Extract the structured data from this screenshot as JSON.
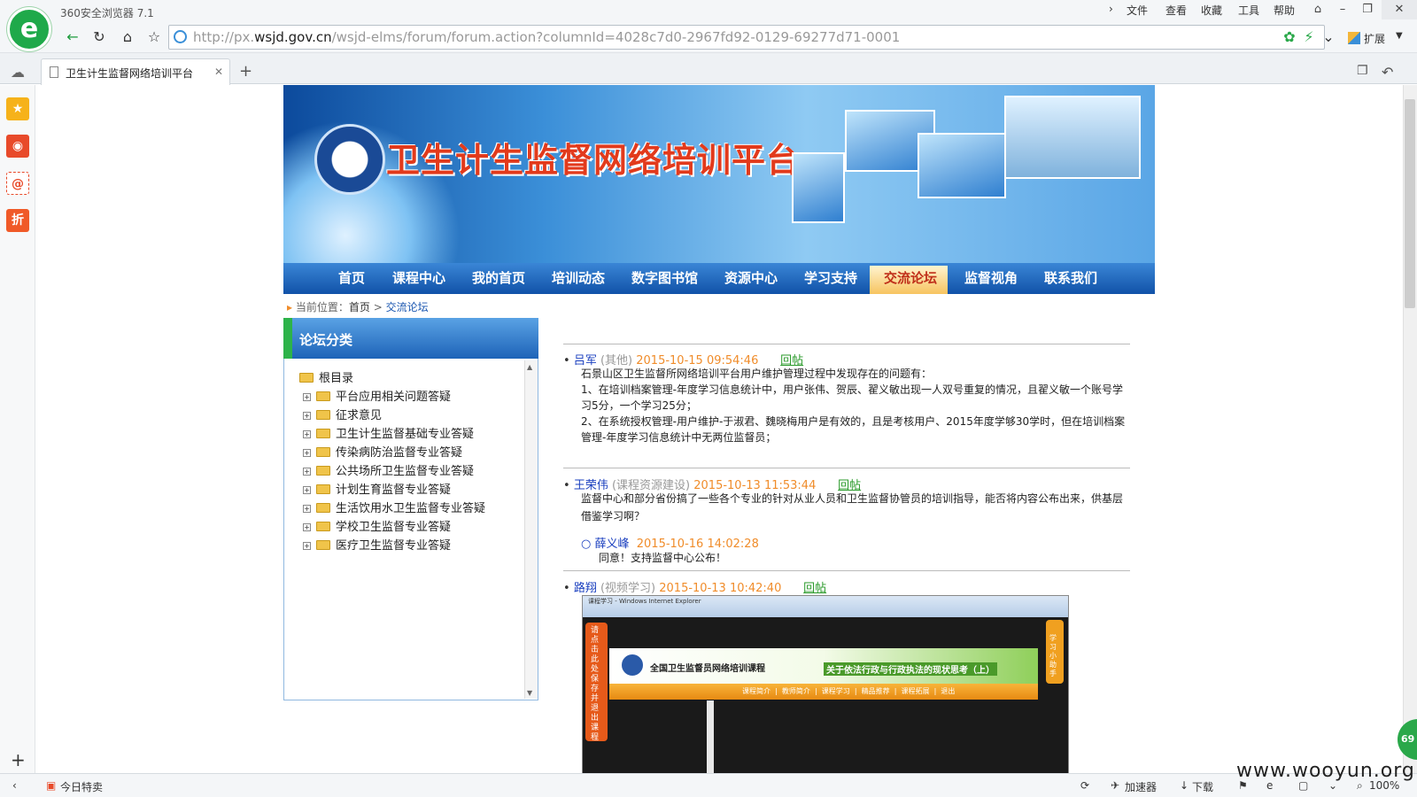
{
  "browser": {
    "app_name": "360安全浏览器 7.1",
    "menu": [
      "文件",
      "查看",
      "收藏",
      "工具",
      "帮助"
    ],
    "url_prefix": "http://px.",
    "url_domain": "wsjd.gov.cn",
    "url_path": "/wsjd-elms/forum/forum.action?columnId=4028c7d0-2967fd92-0129-69277d71-0001",
    "extend_label": "扩展",
    "tab_title": "卫生计生监督网络培训平台",
    "status": {
      "today_deal": "今日特卖",
      "accelerator": "加速器",
      "download": "下载",
      "zoom": "100%"
    }
  },
  "site": {
    "banner_title": "卫生计生监督网络培训平台",
    "nav": [
      "首页",
      "课程中心",
      "我的首页",
      "培训动态",
      "数字图书馆",
      "资源中心",
      "学习支持",
      "交流论坛",
      "监督视角",
      "联系我们"
    ],
    "active_nav": "交流论坛",
    "breadcrumb": {
      "label": "当前位置：",
      "home": "首页",
      "sep": ">",
      "current": "交流论坛"
    }
  },
  "categories": {
    "title": "论坛分类",
    "root": "根目录",
    "items": [
      "平台应用相关问题答疑",
      "征求意见",
      "卫生计生监督基础专业答疑",
      "传染病防治监督专业答疑",
      "公共场所卫生监督专业答疑",
      "计划生育监督专业答疑",
      "生活饮用水卫生监督专业答疑",
      "学校卫生监督专业答疑",
      "医疗卫生监督专业答疑"
    ]
  },
  "posts": [
    {
      "author": "吕军",
      "category": "(其他)",
      "time": "2015-10-15 09:54:46",
      "reply": "回帖",
      "lines": [
        "石景山区卫生监督所网络培训平台用户维护管理过程中发现存在的问题有：",
        "1、在培训档案管理-年度学习信息统计中，用户张伟、贺辰、翟义敏出现一人双号重复的情况，且翟义敏一个账号学",
        "习5分，一个学习25分；",
        "2、在系统授权管理-用户维护-于淑君、魏晓梅用户是有效的，且是考核用户、2015年度学够30学时，但在培训档案",
        "管理-年度学习信息统计中无两位监督员；"
      ]
    },
    {
      "author": "王荣伟",
      "category": "(课程资源建设)",
      "time": "2015-10-13 11:53:44",
      "reply": "回帖",
      "lines": [
        "监督中心和部分省份搞了一些各个专业的针对从业人员和卫生监督协管员的培训指导，能否将内容公布出来，供基层",
        "借鉴学习啊？"
      ],
      "sub_reply": {
        "author": "薛义峰",
        "time": "2015-10-16 14:02:28",
        "text": "同意！支持监督中心公布！"
      }
    },
    {
      "author": "路翔",
      "category": "(视频学习)",
      "time": "2015-10-13 10:42:40",
      "reply": "回帖",
      "screenshot": {
        "window_title": "课程学习 - Windows Internet Explorer",
        "course_title": "全国卫生监督员网络培训课程",
        "lesson_title": "关于依法行政与行政执法的现状思考（上）",
        "nav": [
          "课程简介",
          "教师简介",
          "课程学习",
          "精品推荐",
          "课程拓展",
          "退出"
        ],
        "side_left": "请点击此处保存并退出课程",
        "side_right": "学习小助手"
      }
    }
  ],
  "watermark": "www.wooyun.org",
  "badge": "69"
}
